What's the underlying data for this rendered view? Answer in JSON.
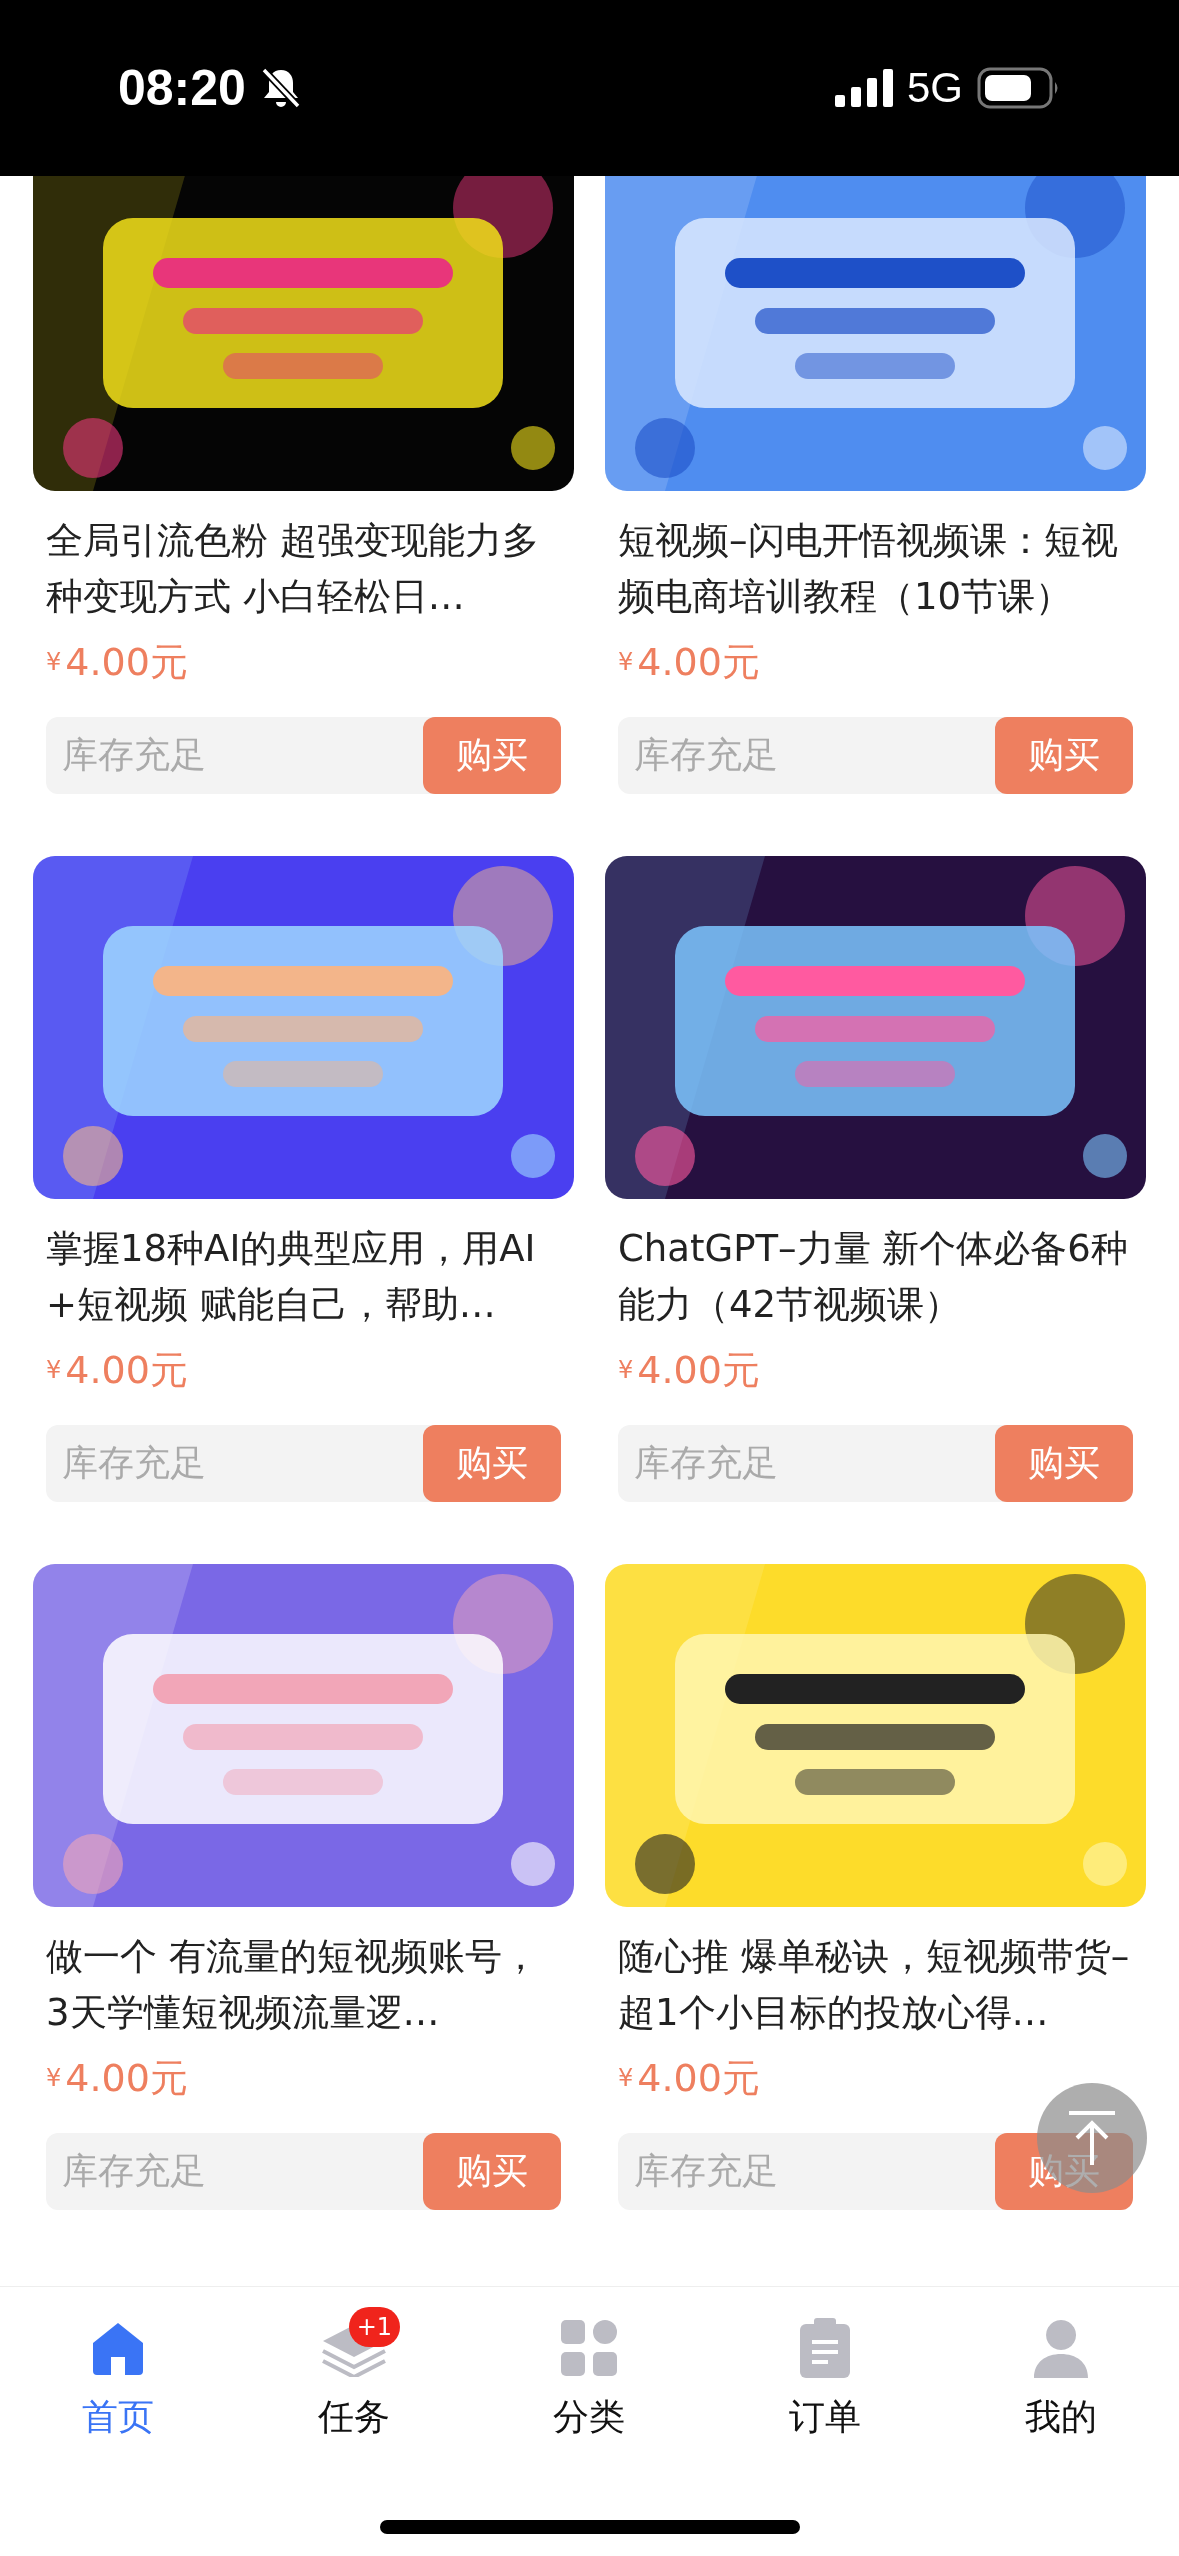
{
  "status_bar": {
    "time": "08:20",
    "network": "5G"
  },
  "products": [
    {
      "title": "全局引流色粉 超强变现能力多种变现方式 小白轻松日…",
      "currency": "¥",
      "price": "4.00元",
      "stock": "库存充足",
      "buy": "购买"
    },
    {
      "title": "短视频–闪电开悟视频课：短视频电商培训教程（10节课）",
      "currency": "¥",
      "price": "4.00元",
      "stock": "库存充足",
      "buy": "购买"
    },
    {
      "title": "掌握18种AI的典型应用，用AI+短视频 赋能自己，帮助…",
      "currency": "¥",
      "price": "4.00元",
      "stock": "库存充足",
      "buy": "购买"
    },
    {
      "title": "ChatGPT–力量 新个体必备6种能力（42节视频课）",
      "currency": "¥",
      "price": "4.00元",
      "stock": "库存充足",
      "buy": "购买"
    },
    {
      "title": "做一个 有流量的短视频账号，3天学懂短视频流量逻…",
      "currency": "¥",
      "price": "4.00元",
      "stock": "库存充足",
      "buy": "购买"
    },
    {
      "title": "随心推 爆单秘诀，短视频带货–超1个小目标的投放心得…",
      "currency": "¥",
      "price": "4.00元",
      "stock": "库存充足",
      "buy": "购买"
    }
  ],
  "tab_bar": [
    {
      "kind": "home",
      "label": "首页",
      "selected": true
    },
    {
      "kind": "tasks",
      "label": "任务",
      "selected": false,
      "badge": "+1"
    },
    {
      "kind": "category",
      "label": "分类",
      "selected": false
    },
    {
      "kind": "orders",
      "label": "订单",
      "selected": false
    },
    {
      "kind": "me",
      "label": "我的",
      "selected": false
    }
  ]
}
